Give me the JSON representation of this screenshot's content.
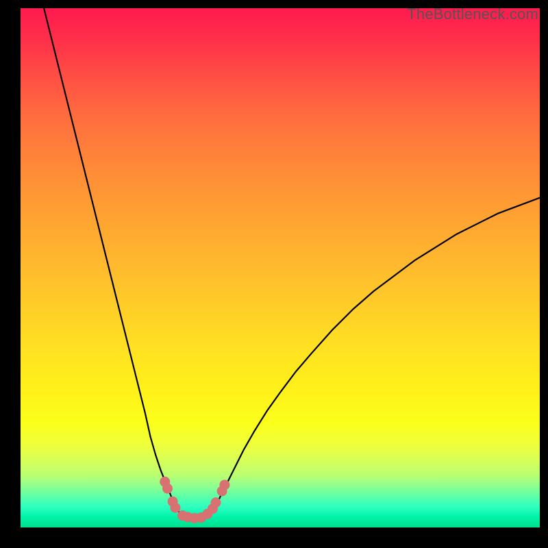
{
  "watermark": "TheBottleneck.com",
  "colors": {
    "background": "#000000",
    "gradient_top": "#ff1a4f",
    "gradient_mid": "#fff21a",
    "gradient_bottom": "#00e08c",
    "curve": "#000000",
    "markers": "#d87171"
  },
  "chart_data": {
    "type": "line",
    "title": "",
    "xlabel": "",
    "ylabel": "",
    "xlim": [
      0,
      100
    ],
    "ylim": [
      0,
      100
    ],
    "series": [
      {
        "name": "left-curve",
        "x": [
          4.5,
          6,
          8,
          10,
          12,
          14,
          16,
          18,
          20,
          22,
          24,
          25,
          26,
          27,
          28,
          29,
          29.8
        ],
        "values": [
          100,
          94,
          86,
          78,
          70,
          62,
          54,
          46,
          38,
          30,
          22,
          17.5,
          14,
          11,
          8.5,
          6,
          4
        ]
      },
      {
        "name": "right-curve",
        "x": [
          37.5,
          38.5,
          40,
          41.5,
          43,
          45,
          47.5,
          50,
          53,
          56,
          60,
          64,
          68,
          72,
          76,
          80,
          84,
          88,
          92,
          96,
          100
        ],
        "values": [
          4,
          6,
          9,
          12,
          15,
          18.5,
          22.5,
          26,
          30,
          33.5,
          38,
          42,
          45.5,
          48.5,
          51.5,
          54,
          56.5,
          58.5,
          60.5,
          62,
          63.5
        ]
      },
      {
        "name": "valley",
        "x": [
          29.8,
          30.5,
          31.2,
          32,
          33,
          34,
          35,
          36,
          36.8,
          37.5
        ],
        "values": [
          4,
          3,
          2.3,
          1.8,
          1.5,
          1.5,
          1.8,
          2.3,
          3,
          4
        ]
      }
    ],
    "markers": [
      {
        "x": 27.8,
        "y": 8.8
      },
      {
        "x": 28.3,
        "y": 7.5
      },
      {
        "x": 29.3,
        "y": 5.0
      },
      {
        "x": 29.8,
        "y": 3.8
      },
      {
        "x": 31.2,
        "y": 2.3
      },
      {
        "x": 32.2,
        "y": 2.0
      },
      {
        "x": 33.5,
        "y": 1.8
      },
      {
        "x": 34.8,
        "y": 1.9
      },
      {
        "x": 36.0,
        "y": 2.6
      },
      {
        "x": 37.0,
        "y": 3.6
      },
      {
        "x": 37.6,
        "y": 4.8
      },
      {
        "x": 38.8,
        "y": 7.0
      },
      {
        "x": 39.3,
        "y": 8.2
      }
    ]
  }
}
